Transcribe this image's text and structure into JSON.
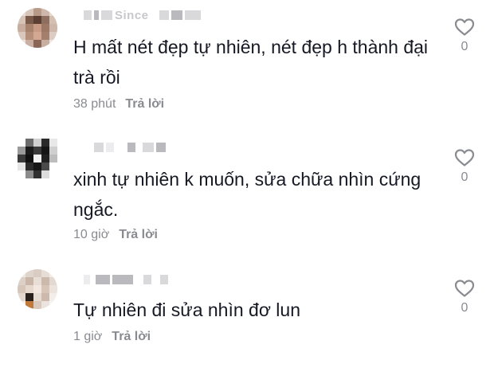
{
  "comments": [
    {
      "username_visible_fragment": "Since",
      "text": "H mất nét đẹp tự nhiên, nét đẹp h thành đại trà rồi",
      "time": "38 phút",
      "reply_label": "Trả lời",
      "like_count": "0",
      "like_icon": "heart-outline-icon"
    },
    {
      "username_visible_fragment": "",
      "text": "xinh tự nhiên k muốn, sửa chữa nhìn cứng ngắc.",
      "time": "10 giờ",
      "reply_label": "Trả lời",
      "like_count": "0",
      "like_icon": "heart-outline-icon"
    },
    {
      "username_visible_fragment": "",
      "text": "Tự nhiên đi sửa nhìn đơ lun",
      "time": "1 giờ",
      "reply_label": "Trả lời",
      "like_count": "0",
      "like_icon": "heart-outline-icon"
    }
  ],
  "colors": {
    "text": "#161823",
    "meta": "#8a8b91",
    "background": "#ffffff"
  }
}
